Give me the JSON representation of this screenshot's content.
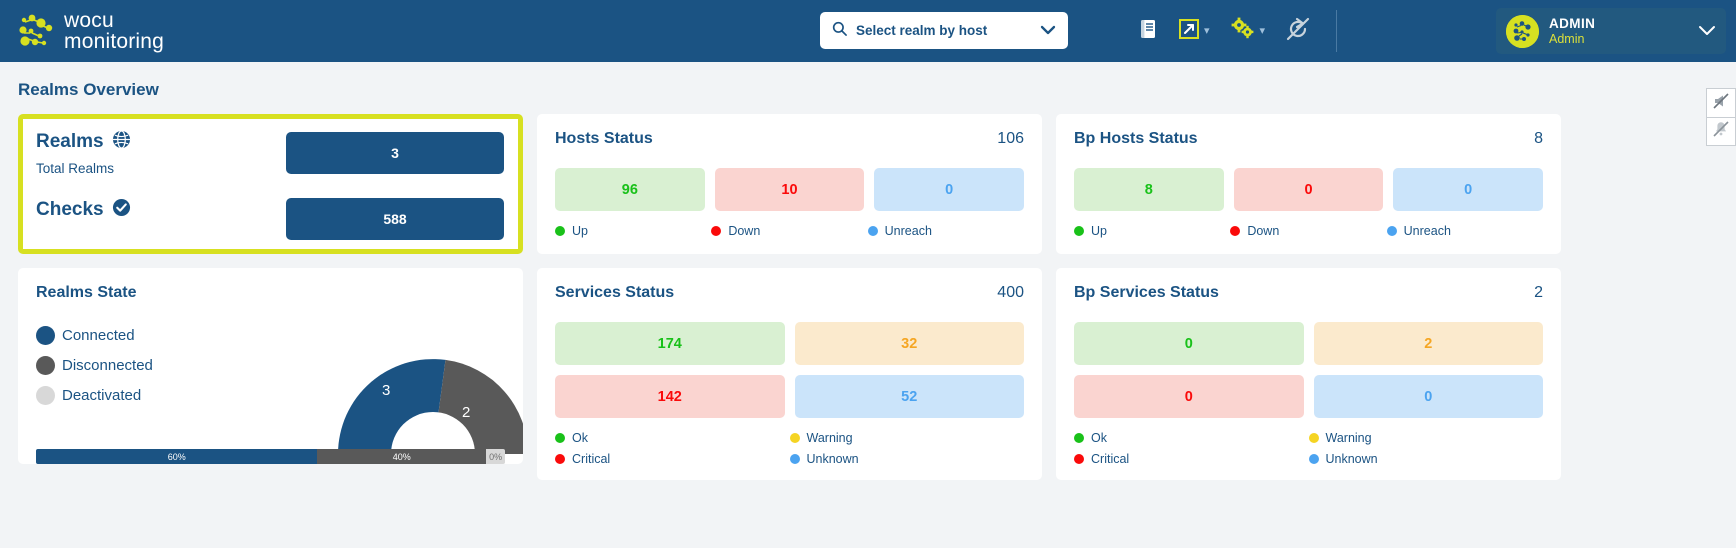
{
  "header": {
    "logo_line1": "wocu",
    "logo_line2": "monitoring",
    "logo_icon": "wocu-dots-logo",
    "search": {
      "placeholder": "Select realm by host",
      "icon": "search-icon",
      "chevron": "chevron-down-icon"
    },
    "icons": [
      {
        "name": "docs-book-icon",
        "label": "Documentation"
      },
      {
        "name": "external-link-icon",
        "label": "Open external"
      },
      {
        "name": "gears-settings-icon",
        "label": "Settings"
      },
      {
        "name": "refresh-disabled-icon",
        "label": "Auto refresh off"
      }
    ],
    "user": {
      "name": "ADMIN",
      "role": "Admin",
      "avatar_icon": "wocu-dots-avatar",
      "chevron": "chevron-down-icon"
    }
  },
  "page": {
    "title": "Realms Overview"
  },
  "float_toggles": [
    {
      "name": "mute-announcements-icon"
    },
    {
      "name": "mute-notifications-icon"
    }
  ],
  "cards": {
    "realms": {
      "realms_label": "Realms",
      "realms_icon": "globe-icon",
      "realms_sub": "Total Realms",
      "realms_value": "3",
      "checks_label": "Checks",
      "checks_icon": "check-circle-icon",
      "checks_value": "588"
    },
    "hosts_status": {
      "title": "Hosts Status",
      "total": "106",
      "tiles": [
        {
          "value": "96",
          "style": "t-green"
        },
        {
          "value": "10",
          "style": "t-red"
        },
        {
          "value": "0",
          "style": "t-blue"
        }
      ],
      "legend": [
        {
          "label": "Up",
          "color": "#19c119"
        },
        {
          "label": "Down",
          "color": "#fa0a0a"
        },
        {
          "label": "Unreach",
          "color": "#4ba3f0"
        }
      ]
    },
    "bp_hosts_status": {
      "title": "Bp Hosts Status",
      "total": "8",
      "tiles": [
        {
          "value": "8",
          "style": "t-green"
        },
        {
          "value": "0",
          "style": "t-red"
        },
        {
          "value": "0",
          "style": "t-blue"
        }
      ],
      "legend": [
        {
          "label": "Up",
          "color": "#19c119"
        },
        {
          "label": "Down",
          "color": "#fa0a0a"
        },
        {
          "label": "Unreach",
          "color": "#4ba3f0"
        }
      ]
    },
    "realms_state": {
      "title": "Realms State",
      "legend": [
        {
          "label": "Connected",
          "color": "#1b5383"
        },
        {
          "label": "Disconnected",
          "color": "#595959"
        },
        {
          "label": "Deactivated",
          "color": "#d8d8d8"
        }
      ],
      "progress": [
        {
          "label": "60%",
          "value": 60,
          "style": "p1"
        },
        {
          "label": "40%",
          "value": 40,
          "style": "p2"
        },
        {
          "label": "0%",
          "value": 0,
          "style": "p3"
        }
      ]
    },
    "services_status": {
      "title": "Services Status",
      "total": "400",
      "tiles": [
        {
          "value": "174",
          "style": "t-green"
        },
        {
          "value": "32",
          "style": "t-amber"
        },
        {
          "value": "142",
          "style": "t-red"
        },
        {
          "value": "52",
          "style": "t-blue"
        }
      ],
      "legend": [
        {
          "label": "Ok",
          "color": "#19c119"
        },
        {
          "label": "Warning",
          "color": "#f5d423"
        },
        {
          "label": "Critical",
          "color": "#fa0a0a"
        },
        {
          "label": "Unknown",
          "color": "#4ba3f0"
        }
      ]
    },
    "bp_services_status": {
      "title": "Bp Services Status",
      "total": "2",
      "tiles": [
        {
          "value": "0",
          "style": "t-green"
        },
        {
          "value": "2",
          "style": "t-amber"
        },
        {
          "value": "0",
          "style": "t-red"
        },
        {
          "value": "0",
          "style": "t-blue"
        }
      ],
      "legend": [
        {
          "label": "Ok",
          "color": "#19c119"
        },
        {
          "label": "Warning",
          "color": "#f5d423"
        },
        {
          "label": "Critical",
          "color": "#fa0a0a"
        },
        {
          "label": "Unknown",
          "color": "#4ba3f0"
        }
      ]
    }
  },
  "chart_data": {
    "type": "pie",
    "title": "Realms State",
    "labels": [
      "Connected",
      "Disconnected",
      "Deactivated"
    ],
    "values": [
      3,
      2,
      0
    ],
    "percentages": [
      60,
      40,
      0
    ],
    "colors": [
      "#1b5383",
      "#595959",
      "#d8d8d8"
    ],
    "legend_position": "left",
    "donut": true,
    "half": true,
    "data_labels": [
      "3",
      "2",
      ""
    ]
  }
}
